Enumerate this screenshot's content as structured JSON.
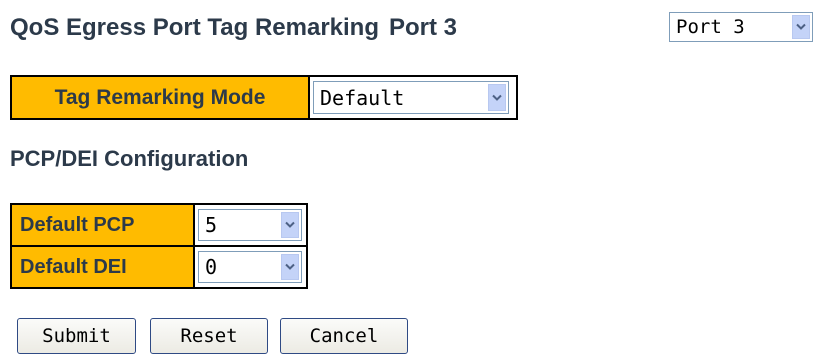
{
  "header": {
    "title": "QoS Egress Port Tag Remarking",
    "port_suffix": "Port 3"
  },
  "port_select": {
    "value": "Port 3",
    "icon": "chevron-down-icon"
  },
  "mode_table": {
    "label": "Tag Remarking Mode",
    "value": "Default"
  },
  "pcp_section": {
    "title": "PCP/DEI Configuration",
    "rows": [
      {
        "label": "Default PCP",
        "value": "5"
      },
      {
        "label": "Default DEI",
        "value": "0"
      }
    ]
  },
  "buttons": {
    "submit": "Submit",
    "reset": "Reset",
    "cancel": "Cancel"
  },
  "colors": {
    "header_cell": "#ffbb00",
    "title_text": "#2c3a4a",
    "dropdown_button": "#c4d3f8",
    "button_border": "#2f4a84"
  }
}
